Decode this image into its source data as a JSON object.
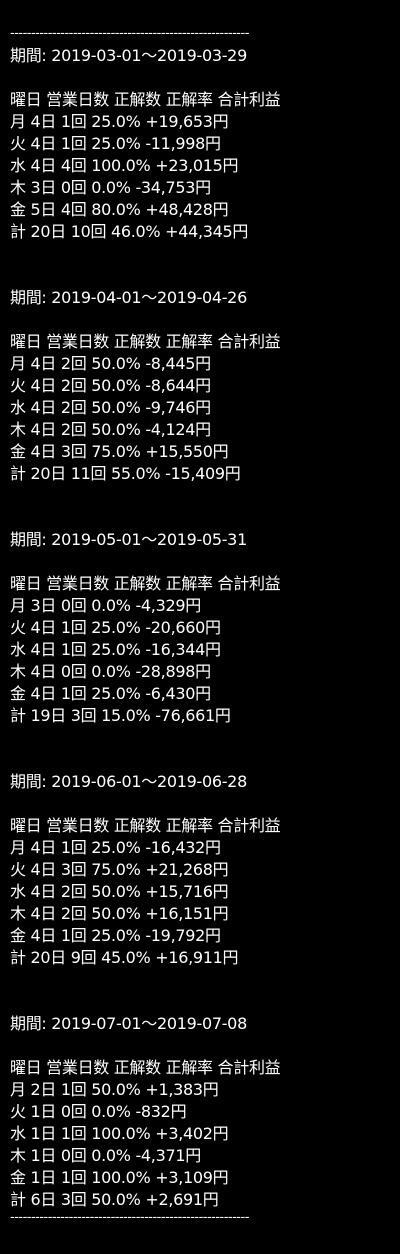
{
  "divider": "---------------------------------------------------------",
  "header_label": "曜日 営業日数 正解数 正解率 合計利益",
  "periods": [
    {
      "period": "期間: 2019-03-01～2019-03-29",
      "rows": [
        "月 4日 1回 25.0% +19,653円",
        "火 4日 1回 25.0% -11,998円",
        "水 4日 4回 100.0% +23,015円",
        "木 3日 0回 0.0% -34,753円",
        "金 5日 4回 80.0% +48,428円",
        "計 20日 10回 46.0% +44,345円"
      ]
    },
    {
      "period": "期間: 2019-04-01～2019-04-26",
      "rows": [
        "月 4日 2回 50.0% -8,445円",
        "火 4日 2回 50.0% -8,644円",
        "水 4日 2回 50.0% -9,746円",
        "木 4日 2回 50.0% -4,124円",
        "金 4日 3回 75.0% +15,550円",
        "計 20日 11回 55.0% -15,409円"
      ]
    },
    {
      "period": "期間: 2019-05-01～2019-05-31",
      "rows": [
        "月 3日 0回 0.0% -4,329円",
        "火 4日 1回 25.0% -20,660円",
        "水 4日 1回 25.0% -16,344円",
        "木 4日 0回 0.0% -28,898円",
        "金 4日 1回 25.0% -6,430円",
        "計 19日 3回 15.0% -76,661円"
      ]
    },
    {
      "period": "期間: 2019-06-01～2019-06-28",
      "rows": [
        "月 4日 1回 25.0% -16,432円",
        "火 4日 3回 75.0% +21,268円",
        "水 4日 2回 50.0% +15,716円",
        "木 4日 2回 50.0% +16,151円",
        "金 4日 1回 25.0% -19,792円",
        "計 20日 9回 45.0% +16,911円"
      ]
    },
    {
      "period": "期間: 2019-07-01～2019-07-08",
      "rows": [
        "月 2日 1回 50.0% +1,383円",
        "火 1日 0回 0.0% -832円",
        "水 1日 1回 100.0% +3,402円",
        "木 1日 0回 0.0% -4,371円",
        "金 1日 1回 100.0% +3,109円",
        "計 6日 3回 50.0% +2,691円"
      ]
    }
  ]
}
